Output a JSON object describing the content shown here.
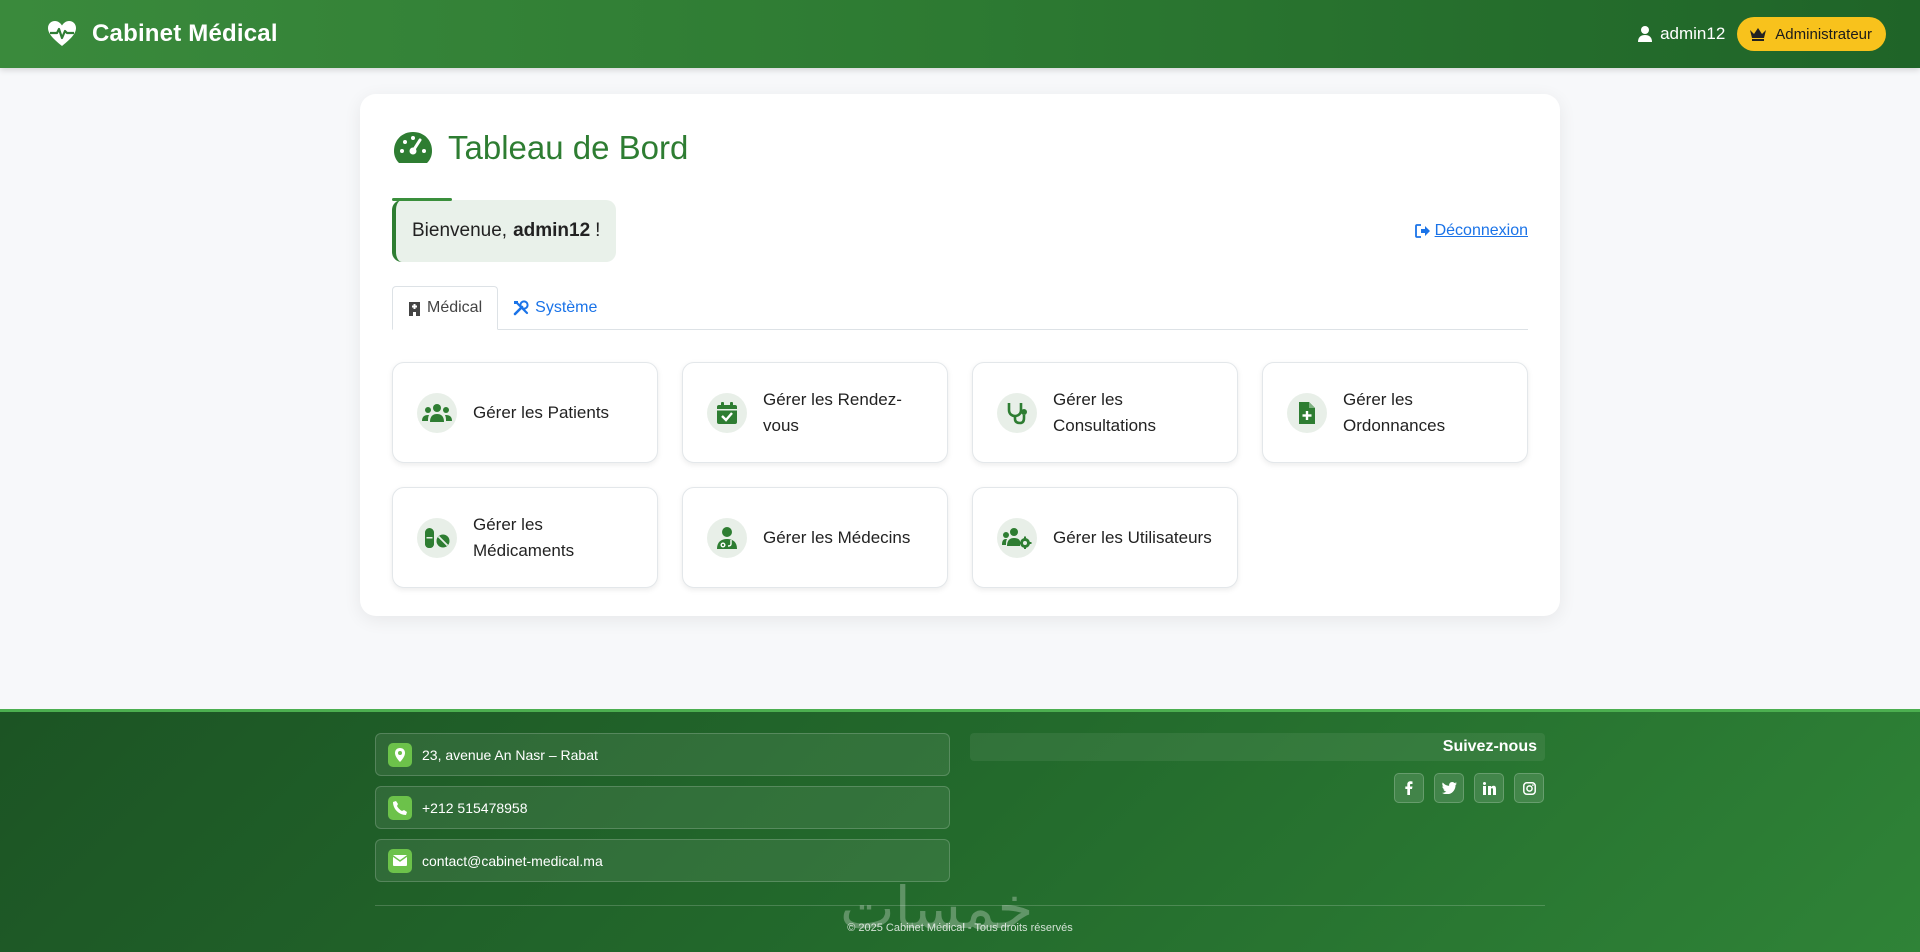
{
  "navbar": {
    "brand": "Cabinet Médical",
    "username": "admin12",
    "role": "Administrateur"
  },
  "dashboard": {
    "title": "Tableau de Bord",
    "welcome_prefix": "Bienvenue,",
    "welcome_user": "admin12",
    "welcome_suffix": "!",
    "logout_label": "Déconnexion",
    "tabs": [
      {
        "label": "Médical",
        "icon": "hospital-icon",
        "active": true
      },
      {
        "label": "Système",
        "icon": "tools-icon",
        "active": false
      }
    ],
    "tiles": [
      {
        "label": "Gérer les Patients",
        "icon": "users-icon"
      },
      {
        "label": "Gérer les Rendez-vous",
        "icon": "calendar-check-icon"
      },
      {
        "label": "Gérer les Consultations",
        "icon": "stethoscope-icon"
      },
      {
        "label": "Gérer les Ordonnances",
        "icon": "file-medical-icon"
      },
      {
        "label": "Gérer les Médicaments",
        "icon": "pills-icon"
      },
      {
        "label": "Gérer les Médecins",
        "icon": "doctor-icon"
      },
      {
        "label": "Gérer les Utilisateurs",
        "icon": "users-cog-icon"
      }
    ]
  },
  "footer": {
    "address": "23, avenue An Nasr – Rabat",
    "phone": "+212 515478958",
    "email": "contact@cabinet-medical.ma",
    "follow_title": "Suivez-nous",
    "socials": [
      "facebook-icon",
      "twitter-icon",
      "linkedin-icon",
      "instagram-icon"
    ],
    "watermark": "خمسات",
    "copyright": "© 2025 Cabinet Médical - Tous droits réservés"
  },
  "colors": {
    "primary": "#2e7d32",
    "accent": "#f8c21c",
    "link": "#1a73e8"
  }
}
